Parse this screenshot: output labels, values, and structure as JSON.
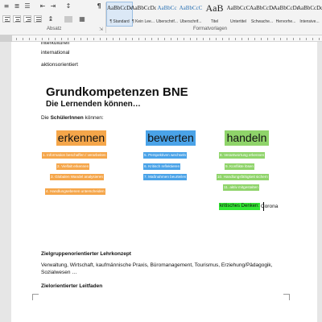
{
  "ribbon": {
    "absatz_label": "Absatz",
    "formatvorlagen_label": "Formatvorlagen",
    "para_mark": "¶",
    "styles": [
      {
        "sample": "AaBbCcDc",
        "name": "¶ Standard",
        "selected": true
      },
      {
        "sample": "AaBbCcDc",
        "name": "¶ Kein Lee...",
        "selected": false
      },
      {
        "sample": "AaBbCc",
        "name": "Überschrif...",
        "selected": false
      },
      {
        "sample": "AaBbCcC",
        "name": "Überschrif...",
        "selected": false
      },
      {
        "sample": "AaB",
        "name": "Titel",
        "selected": false
      },
      {
        "sample": "AaBbCcC",
        "name": "Untertitel",
        "selected": false
      },
      {
        "sample": "AaBbCcDc",
        "name": "Schwache...",
        "selected": false
      },
      {
        "sample": "AaBbCcDc",
        "name": "Hervorhe...",
        "selected": false
      },
      {
        "sample": "AaBbCcDc",
        "name": "Intensive...",
        "selected": false
      }
    ]
  },
  "document": {
    "lines_top": [
      "interkulturell",
      "international",
      "aktionsorientiert"
    ],
    "title": "Grundkompetenzen BNE",
    "subtitle": "Die Lernenden können…",
    "intro_prefix": "Die ",
    "intro_bold": "SchülerInnen",
    "intro_suffix": " können:",
    "columns": [
      {
        "heading": "erkennen",
        "color": "#f5a64a",
        "items": [
          "1. Information beschaffen / verarbeiten",
          "2. Vielfalt erkennen",
          "3. Globalen Wandel analysieren",
          "4. Handlungsebenen unterscheiden"
        ]
      },
      {
        "heading": "bewerten",
        "color": "#4aa3e8",
        "items": [
          "5. Perspektiven wechseln",
          "6. Kritisch reflektieren",
          "7. Maßnahmen beurteilen"
        ]
      },
      {
        "heading": "handeln",
        "color": "#8fd46a",
        "items": [
          "8. Verantwortung erkennen",
          "9. Konflikte lösen",
          "10. Handlungsfähigkeit sichern",
          "11. aktiv mitgestalten"
        ]
      }
    ],
    "highlight_text": "kritisches Denken: ",
    "highlight_color": "#35e835",
    "after_highlight": "Corona",
    "section1_title": "Zielgruppenorientierter Lehrkonzept",
    "section1_body_line1": "Verwaltung, Wirtschaft, kaufmännische Praxis, Büromanagement, Tourismus, Erziehung/Pädagogik,",
    "section1_body_line2": "Sozialwesen …",
    "section2_title": "Zielorientierter Leitfaden"
  }
}
